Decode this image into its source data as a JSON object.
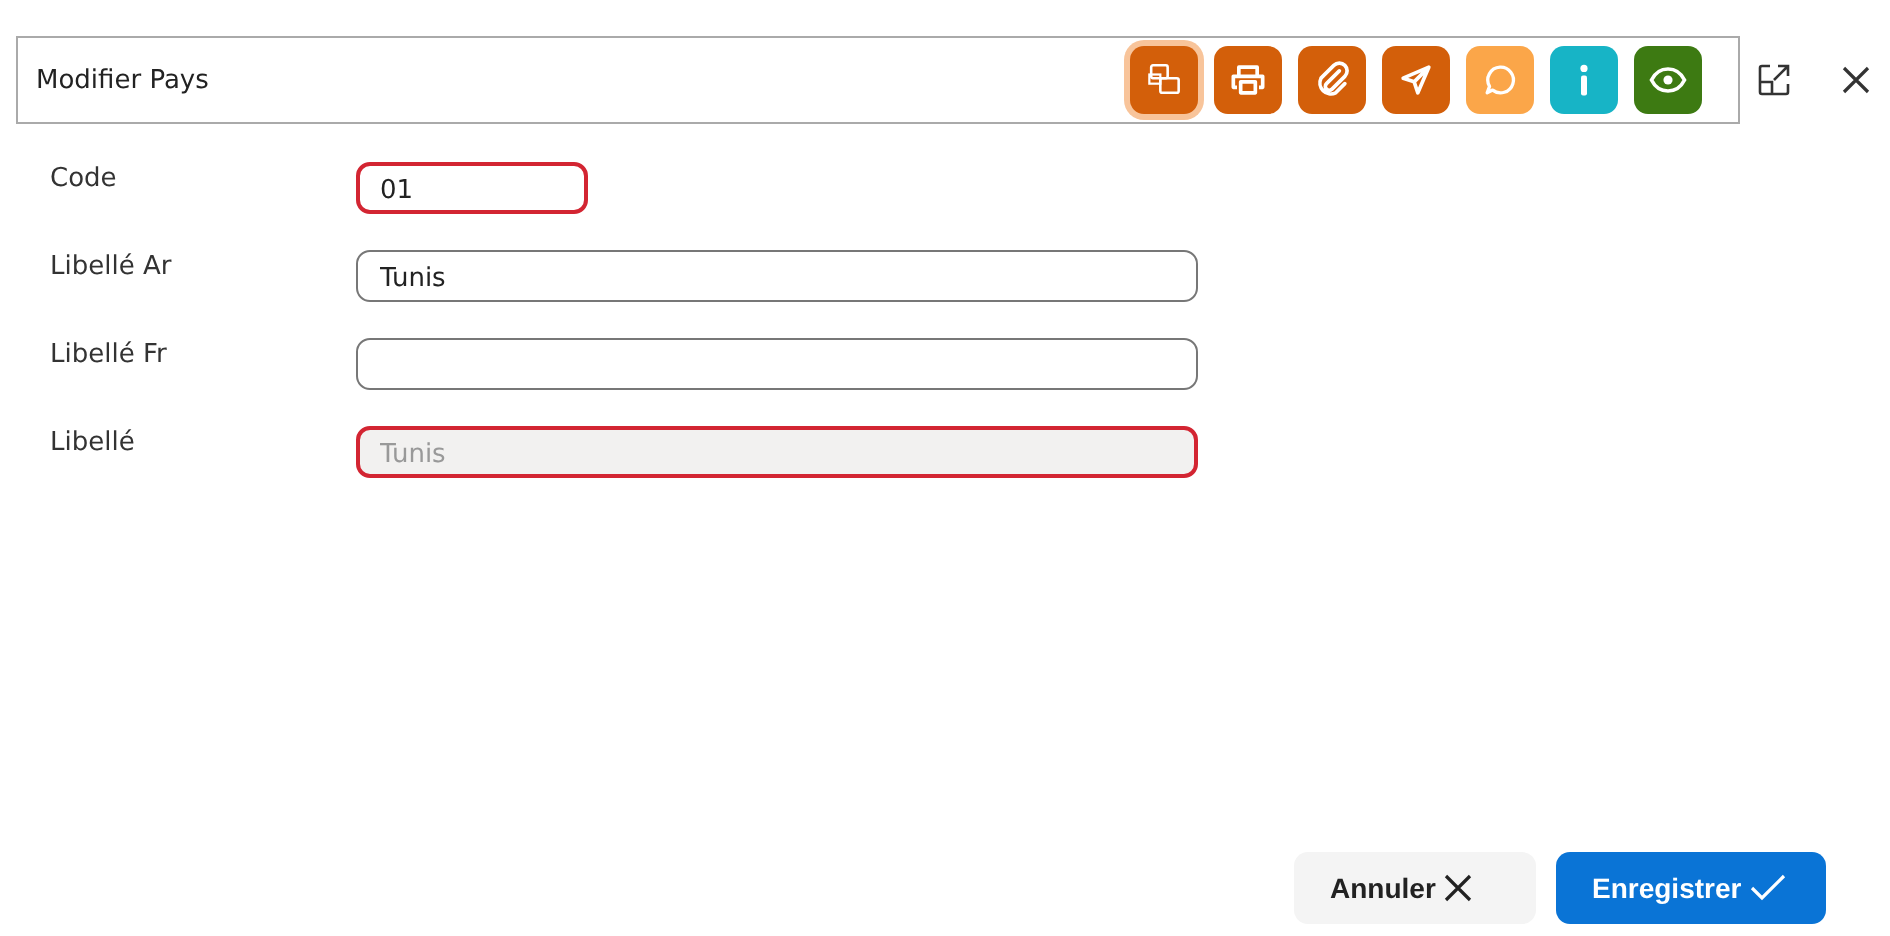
{
  "window": {
    "title": "Modifier Pays"
  },
  "toolbar": [
    {
      "kind": "printers",
      "color": "#d35f0a",
      "selected": true
    },
    {
      "kind": "print",
      "color": "#d35f0a",
      "selected": false
    },
    {
      "kind": "attach",
      "color": "#d35f0a",
      "selected": false
    },
    {
      "kind": "send",
      "color": "#d35f0a",
      "selected": false
    },
    {
      "kind": "comment",
      "color": "#fba649",
      "selected": false
    },
    {
      "kind": "info",
      "color": "#17b4c6",
      "selected": false
    },
    {
      "kind": "view",
      "color": "#3d7a12",
      "selected": false
    }
  ],
  "fields": [
    {
      "label": "Code",
      "value": "01",
      "kind": "short",
      "invalid": true,
      "disabled": false
    },
    {
      "label": "Libellé Ar",
      "value": "Tunis",
      "kind": "wide",
      "invalid": false,
      "disabled": false
    },
    {
      "label": "Libellé Fr",
      "kind": "wide",
      "invalid": false,
      "disabled": false
    },
    {
      "label": "Libellé",
      "value": "Tunis",
      "kind": "wide",
      "invalid": true,
      "disabled": true
    }
  ],
  "buttons": [
    {
      "label": "Annuler",
      "kind": "cancel"
    },
    {
      "label": "Enregistrer",
      "kind": "save"
    }
  ]
}
